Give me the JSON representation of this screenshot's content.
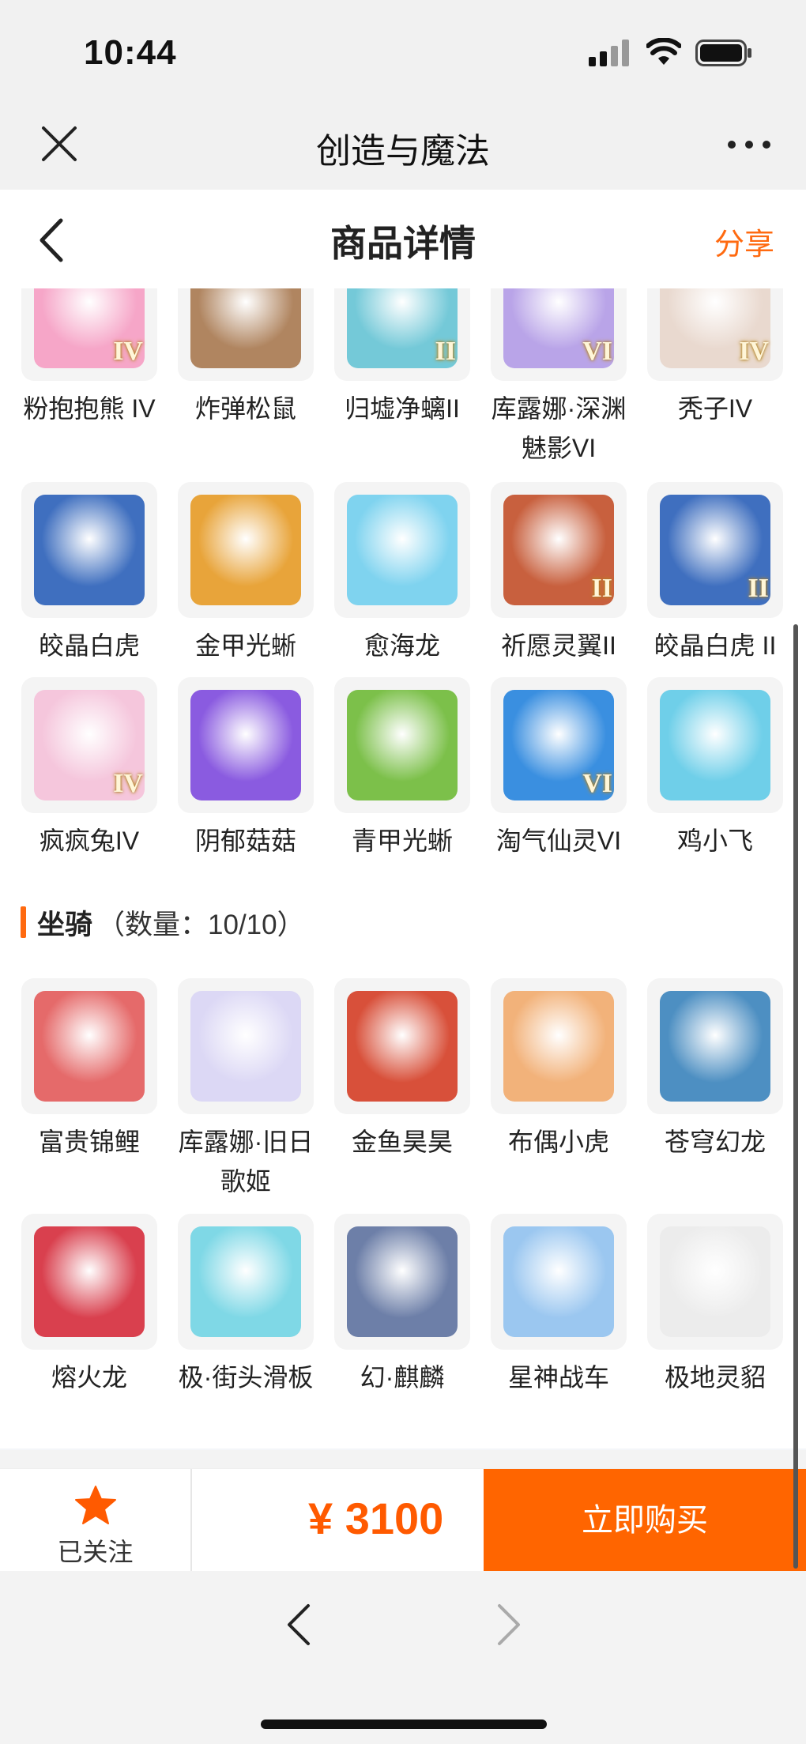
{
  "status": {
    "time": "10:44"
  },
  "app": {
    "title": "创造与魔法"
  },
  "nav": {
    "title": "商品详情",
    "share": "分享"
  },
  "pets_rows": [
    [
      {
        "name": "粉抱抱熊 IV",
        "badge": "IV",
        "color": "#f6a6c8",
        "icon": "pink-bear-icon"
      },
      {
        "name": "炸弹松鼠",
        "badge": "",
        "color": "#b08560",
        "icon": "squirrel-icon"
      },
      {
        "name": "归墟净螭II",
        "badge": "II",
        "color": "#74c9d8",
        "icon": "teal-dragon-icon"
      },
      {
        "name": "库露娜·深渊魅影VI",
        "badge": "VI",
        "color": "#b9a4e8",
        "icon": "kuluna-icon"
      },
      {
        "name": "秃子IV",
        "badge": "IV",
        "color": "#e9d9cf",
        "icon": "bald-boy-icon"
      }
    ],
    [
      {
        "name": "皎晶白虎",
        "badge": "",
        "color": "#3f6fbf",
        "icon": "white-tiger-icon"
      },
      {
        "name": "金甲光蜥",
        "badge": "",
        "color": "#e8a43a",
        "icon": "golden-lizard-icon"
      },
      {
        "name": "愈海龙",
        "badge": "",
        "color": "#7fd3ef",
        "icon": "sea-dragon-icon"
      },
      {
        "name": "祈愿灵翼II",
        "badge": "II",
        "color": "#c8603e",
        "icon": "winged-bird-icon"
      },
      {
        "name": "皎晶白虎 II",
        "badge": "II",
        "color": "#3f6fbf",
        "icon": "white-tiger-icon"
      }
    ],
    [
      {
        "name": "疯疯兔IV",
        "badge": "IV",
        "color": "#f5c6dc",
        "icon": "rabbit-icon"
      },
      {
        "name": "阴郁菇菇",
        "badge": "",
        "color": "#8a5be0",
        "icon": "mushroom-icon"
      },
      {
        "name": "青甲光蜥",
        "badge": "",
        "color": "#7cc04a",
        "icon": "green-lizard-icon"
      },
      {
        "name": "淘气仙灵VI",
        "badge": "VI",
        "color": "#3a8fe0",
        "icon": "naughty-sprite-icon"
      },
      {
        "name": "鸡小飞",
        "badge": "",
        "color": "#6fcfe9",
        "icon": "chick-icon"
      }
    ]
  ],
  "mounts": {
    "title": "坐骑",
    "count": "（数量：10/10）",
    "rows": [
      [
        {
          "name": "富贵锦鲤",
          "badge": "",
          "color": "#e56a6a",
          "icon": "koi-icon"
        },
        {
          "name": "库露娜·旧日歌姬",
          "badge": "",
          "color": "#dcd8f5",
          "icon": "kuluna-singer-icon"
        },
        {
          "name": "金鱼昊昊",
          "badge": "",
          "color": "#d8503a",
          "icon": "goldfish-icon"
        },
        {
          "name": "布偶小虎",
          "badge": "",
          "color": "#f2b27a",
          "icon": "cloth-tiger-icon"
        },
        {
          "name": "苍穹幻龙",
          "badge": "",
          "color": "#4d8fc2",
          "icon": "sky-dragon-icon"
        }
      ],
      [
        {
          "name": "熔火龙",
          "badge": "",
          "color": "#d9404e",
          "icon": "lava-dragon-icon"
        },
        {
          "name": "极·街头滑板",
          "badge": "",
          "color": "#7fd8e6",
          "icon": "skateboard-icon"
        },
        {
          "name": "幻·麒麟",
          "badge": "",
          "color": "#6d7fa8",
          "icon": "qilin-icon"
        },
        {
          "name": "星神战车",
          "badge": "",
          "color": "#9bc7f0",
          "icon": "star-chariot-icon"
        },
        {
          "name": "极地灵貂",
          "badge": "",
          "color": "#ececec",
          "icon": "polar-marten-icon"
        }
      ]
    ]
  },
  "buy_bar": {
    "follow": "已关注",
    "price": "¥ 3100",
    "buy": "立即购买"
  },
  "colors": {
    "accent": "#ff6500",
    "share": "#ff6a10"
  }
}
